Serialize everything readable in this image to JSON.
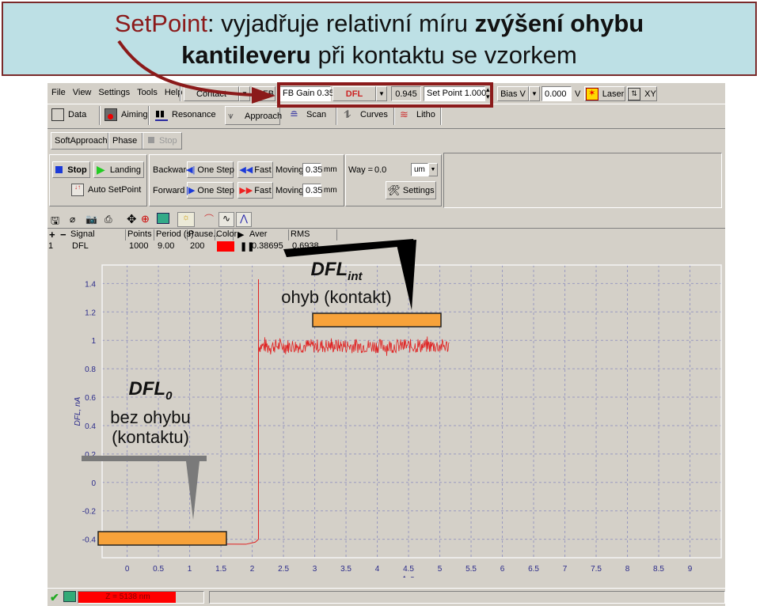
{
  "banner": {
    "setpoint_word": "SetPoint",
    "line1_rest": ": vyjadřuje relativní míru ",
    "line1_bold": "zvýšení ohybu",
    "line2_bold": "kantileveru",
    "line2_rest": " při kontaktu se vzorkem"
  },
  "menu": [
    "File",
    "View",
    "Settings",
    "Tools",
    "Help"
  ],
  "toolbar1": {
    "mode_select": "Contact",
    "fb_label": "FB",
    "fb_gain_label": "FB Gain",
    "fb_gain_value": "0.350",
    "signal_select": "DFL",
    "signal_value": "0.945",
    "setpoint_label": "Set Point",
    "setpoint_value": "1.000",
    "bias_select": "Bias V",
    "bias_value": "0.000",
    "bias_unit": "V",
    "laser_label": "Laser",
    "xy_label": "XY"
  },
  "tabs": [
    "Data",
    "Aiming",
    "Resonance",
    "Approach",
    "Scan",
    "Curves",
    "Litho"
  ],
  "active_tab": "Approach",
  "subtabs": [
    "SoftApproach",
    "Phase",
    "Stop"
  ],
  "approach": {
    "stop_label": "Stop",
    "landing_label": "Landing",
    "auto_setpoint_label": "Auto SetPoint",
    "backward_label": "Backward",
    "forward_label": "Forward",
    "one_step_label": "One Step",
    "fast_label": "Fast",
    "moving_label": "Moving",
    "moving_back_value": "0.35",
    "moving_fwd_value": "0.35",
    "moving_unit": "mm",
    "way_label": "Way =",
    "way_value": "0.0",
    "way_unit": "um",
    "settings_label": "Settings"
  },
  "signal_table": {
    "headers": [
      "Signal",
      "Points",
      "Period (s)",
      "Pause...",
      "Color",
      "Aver",
      "RMS"
    ],
    "rows": [
      {
        "index": "1",
        "signal": "DFL",
        "points": "1000",
        "period": "9.00",
        "pause": "200",
        "color": "#ff0000",
        "aver": "0.38695",
        "rms": "0.6938"
      }
    ]
  },
  "status": {
    "z_text": "Z = 5138 nm",
    "z_fraction": 0.78
  },
  "annotations": {
    "dfl_int_main": "DFL",
    "dfl_int_sub": "int",
    "dfl_int_desc": "ohyb (kontakt)",
    "dfl0_main": "DFL",
    "dfl0_sub": "0",
    "dfl0_desc1": "bez ohybu",
    "dfl0_desc2": "(kontaktu)"
  },
  "chart_data": {
    "type": "line",
    "title": "",
    "xlabel": "t, s",
    "ylabel": "DFL, nA",
    "xlim": [
      -0.4,
      9.5
    ],
    "ylim": [
      -0.53,
      1.53
    ],
    "xticks": [
      "0",
      "0.5",
      "1",
      "1.5",
      "2",
      "2.5",
      "3",
      "3.5",
      "4",
      "4.5",
      "5",
      "5.5",
      "6",
      "6.5",
      "7",
      "7.5",
      "8",
      "8.5",
      "9"
    ],
    "xtick_values": [
      0,
      0.5,
      1,
      1.5,
      2,
      2.5,
      3,
      3.5,
      4,
      4.5,
      5,
      5.5,
      6,
      6.5,
      7,
      7.5,
      8,
      8.5,
      9
    ],
    "yticks": [
      "-0.4",
      "-0.2",
      "0",
      "0.2",
      "0.4",
      "0.6",
      "0.8",
      "1",
      "1.2",
      "1.4"
    ],
    "ytick_values": [
      -0.4,
      -0.2,
      0,
      0.2,
      0.4,
      0.6,
      0.8,
      1,
      1.2,
      1.4
    ],
    "grid": true,
    "series": [
      {
        "name": "DFL",
        "color": "#e02020",
        "segments": [
          {
            "x": [
              0,
              1.9,
              2.05,
              2.1
            ],
            "y": [
              -0.43,
              -0.435,
              -0.42,
              -0.4
            ]
          },
          {
            "x": [
              2.1,
              2.1
            ],
            "y": [
              -0.4,
              1.43
            ]
          },
          {
            "x": [
              2.1,
              5.15
            ],
            "y_mean": 0.96,
            "noise_amplitude": 0.05
          }
        ]
      }
    ]
  }
}
